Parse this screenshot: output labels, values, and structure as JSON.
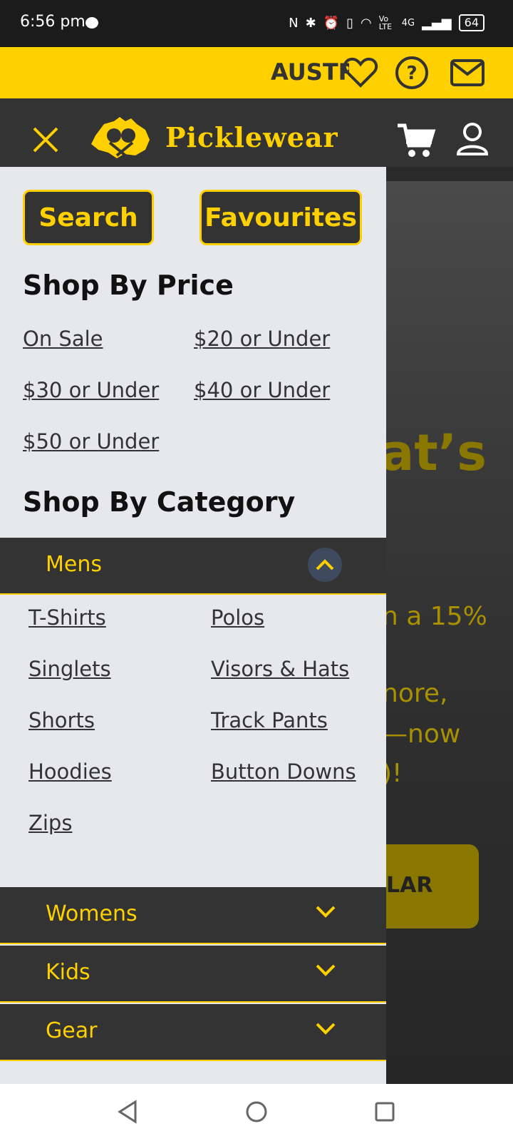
{
  "status_bar": {
    "time": "6:56 pm",
    "battery": "64",
    "network": "4G",
    "volte": "Vo LTE"
  },
  "top_bar": {
    "country": "AUSTRALIA",
    "icons": [
      "heart-icon",
      "help-icon",
      "mail-icon"
    ]
  },
  "header": {
    "brand": "Picklewear",
    "icons": [
      "close-icon",
      "logo-icon",
      "cart-icon",
      "account-icon"
    ]
  },
  "drawer": {
    "search_label": "Search",
    "favourites_label": "Favourites",
    "shop_by_price_title": "Shop By Price",
    "price_links": [
      "On Sale",
      "$20 or Under",
      "$30 or Under",
      "$40 or Under",
      "$50 or Under"
    ],
    "shop_by_category_title": "Shop By Category",
    "categories": [
      {
        "label": "Mens",
        "expanded": true,
        "items": [
          "T-Shirts",
          "Polos",
          "Singlets",
          "Visors & Hats",
          "Shorts",
          "Track Pants",
          "Hoodies",
          "Button Downs",
          "Zips"
        ]
      },
      {
        "label": "Womens",
        "expanded": false
      },
      {
        "label": "Kids",
        "expanded": false
      },
      {
        "label": "Gear",
        "expanded": false
      }
    ]
  },
  "hero_partial": {
    "line1": "at’s",
    "line2": "n a 15%",
    "line3": "nore,",
    "line4": "—now",
    "line5": ")!",
    "button": "LAR"
  },
  "colors": {
    "accent": "#fed000",
    "dark": "#333333",
    "drawer_bg": "#e7e8ec"
  }
}
